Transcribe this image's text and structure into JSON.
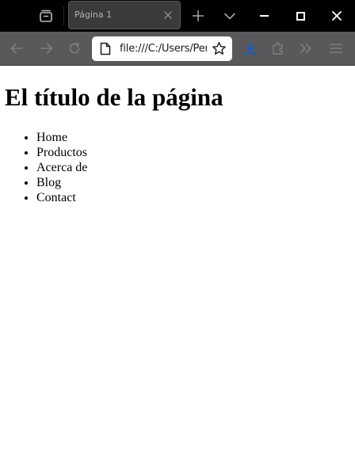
{
  "tabbar": {
    "tab_title": "Página 1",
    "icons": {
      "tab_list": "tab-list-icon",
      "tab_close": "close-icon",
      "new_tab": "plus-icon",
      "tab_overflow": "chevron-down-icon"
    }
  },
  "window_controls": {
    "minimize": "minimize-icon",
    "maximize": "maximize-icon",
    "close": "close-icon"
  },
  "navbar": {
    "url": "file:///C:/Users/Pere",
    "icons": {
      "back": "arrow-left-icon",
      "forward": "arrow-right-icon",
      "reload": "reload-icon",
      "page": "page-icon",
      "bookmark": "star-icon",
      "download": "download-icon",
      "extensions": "puzzle-icon",
      "more_tools": "double-chevron-right-icon",
      "menu": "hamburger-icon"
    },
    "colors": {
      "toolbar_bg": "#59595c",
      "download_accent": "#0a5ed8"
    }
  },
  "page": {
    "title": "El título de la página",
    "menu_items": [
      {
        "label": "Home"
      },
      {
        "label": "Productos"
      },
      {
        "label": "Acerca de"
      },
      {
        "label": "Blog"
      },
      {
        "label": "Contact"
      }
    ]
  }
}
